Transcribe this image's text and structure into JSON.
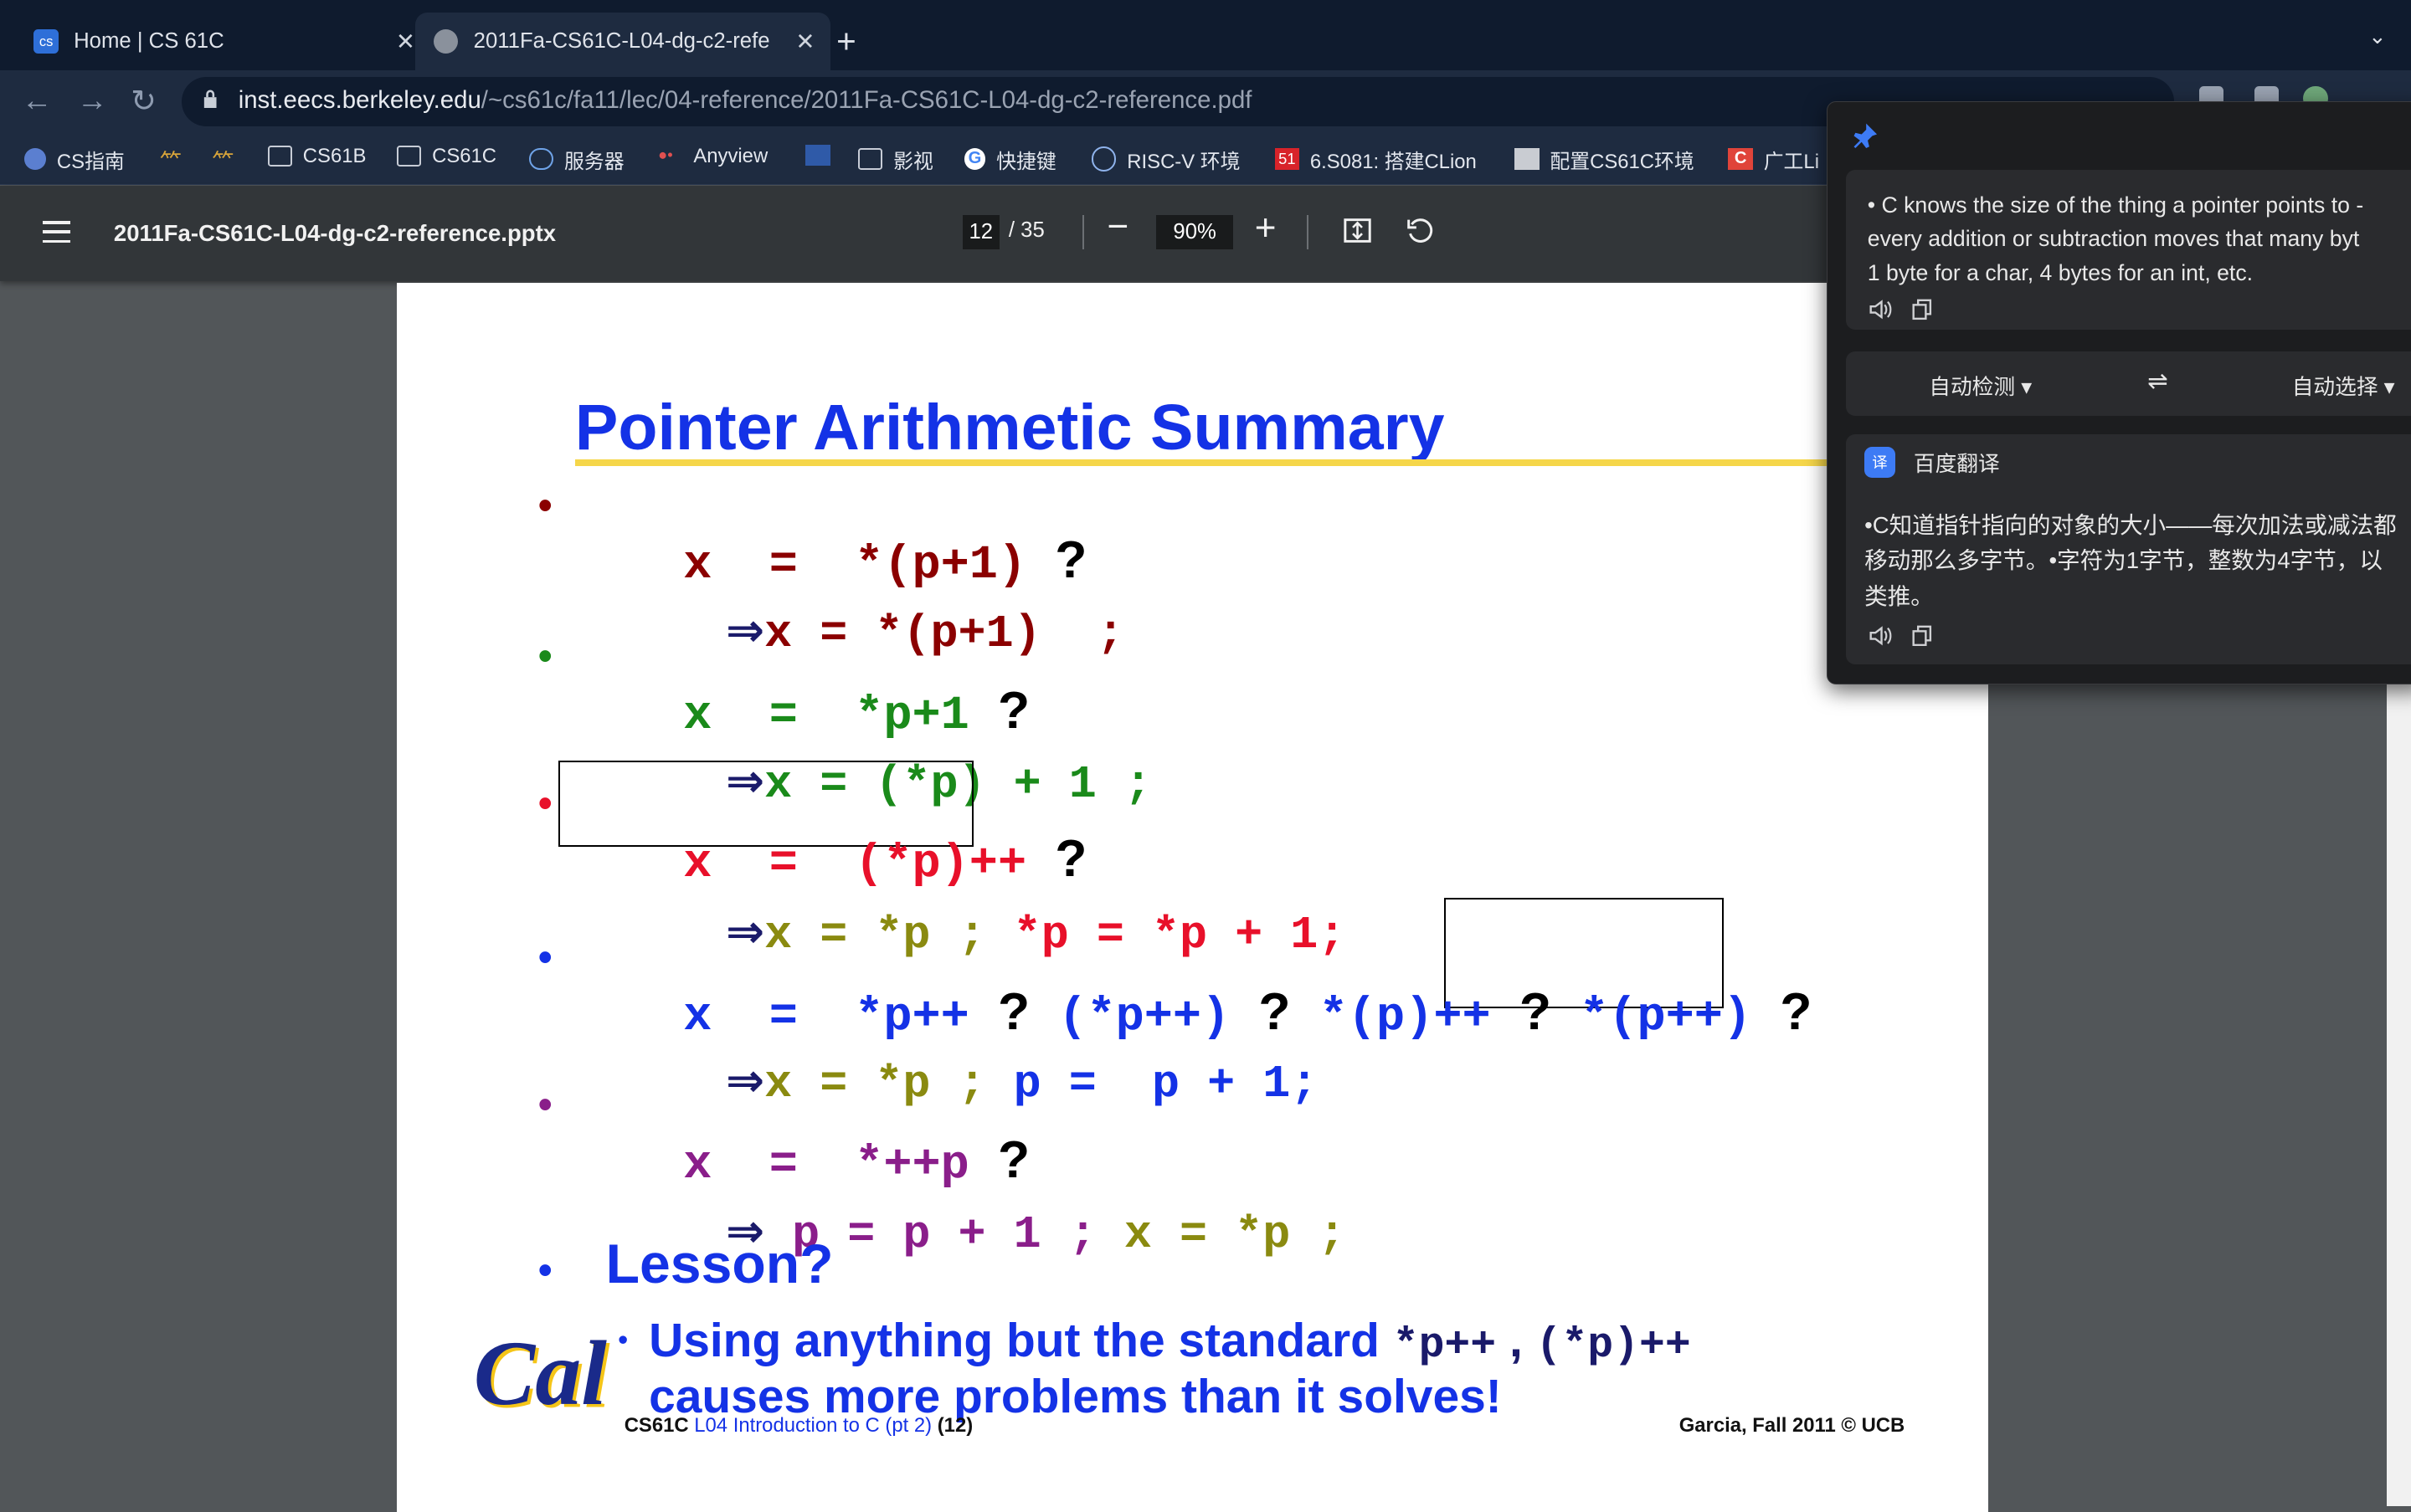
{
  "browser": {
    "tabs": [
      {
        "title": "Home | CS 61C",
        "favicon": "cs61c-icon"
      },
      {
        "title": "2011Fa-CS61C-L04-dg-c2-refe",
        "favicon": "globe-icon"
      }
    ],
    "url_host": "inst.eecs.berkeley.edu",
    "url_path": "/~cs61c/fa11/lec/04-reference/2011Fa-CS61C-L04-dg-c2-reference.pdf",
    "bookmarks": [
      "CS指南",
      "CS61B",
      "CS61C",
      "服务器",
      "Anyview",
      "影视",
      "快捷键",
      "RISC-V 环境",
      "6.S081: 搭建CLion",
      "配置CS61C环境",
      "广工Li"
    ]
  },
  "pdf": {
    "filename": "2011Fa-CS61C-L04-dg-c2-reference.pptx",
    "page_current": "12",
    "page_total": "/ 35",
    "zoom": "90%"
  },
  "slide": {
    "title": "Pointer Arithmetic Summary",
    "lines": {
      "l1": "x  =  *(p+1)",
      "l1s": "x = *(p+1)  ;",
      "l2": "x  =  *p+1",
      "l2s": "x = (*p) + 1 ;",
      "l3": "x  =  (*p)++",
      "l3s_a": "x = *p ; ",
      "l3s_b": "*p = *p + 1;",
      "l4_a": "x  =  *p++",
      "l4_b": "(*p++)",
      "l4_c": "*(p)++",
      "l4_d": "*(p++)",
      "l4s_a": "x = *p ; ",
      "l4s_b": "p =  p + 1;",
      "l5": "x  =  *++p",
      "l5s_a": "p = p + 1 ; ",
      "l5s_b": "x = *p ;"
    },
    "q": "?",
    "arrow": "⇒",
    "bullet": "•",
    "lesson": "Lesson?",
    "lesson_sub_1": "Using anything but the standard ",
    "lesson_code_1": "*p++",
    "lesson_comma": " , ",
    "lesson_code_2": "(*p)++",
    "lesson_sub_2": "causes more problems than it solves!",
    "logo": "Cal",
    "footer_course": "CS61C",
    "footer_lecture": "L04 Introduction to C (pt 2)",
    "footer_page": "(12)",
    "footer_right": "Garcia, Fall 2011 © UCB"
  },
  "translate": {
    "source_text": "• C knows the size of the thing a pointer points to -\nevery addition or subtraction moves that many byt\n1 byte for a char, 4 bytes for an int, etc.",
    "source_lang": "自动检测",
    "swap": "⇌",
    "target_lang": "自动选择",
    "engine": "百度翻译",
    "result_text": "•C知道指针指向的对象的大小——每次加法或减法都\n移动那么多字节。•字符为1字节，整数为4字节，以\n类推。"
  }
}
